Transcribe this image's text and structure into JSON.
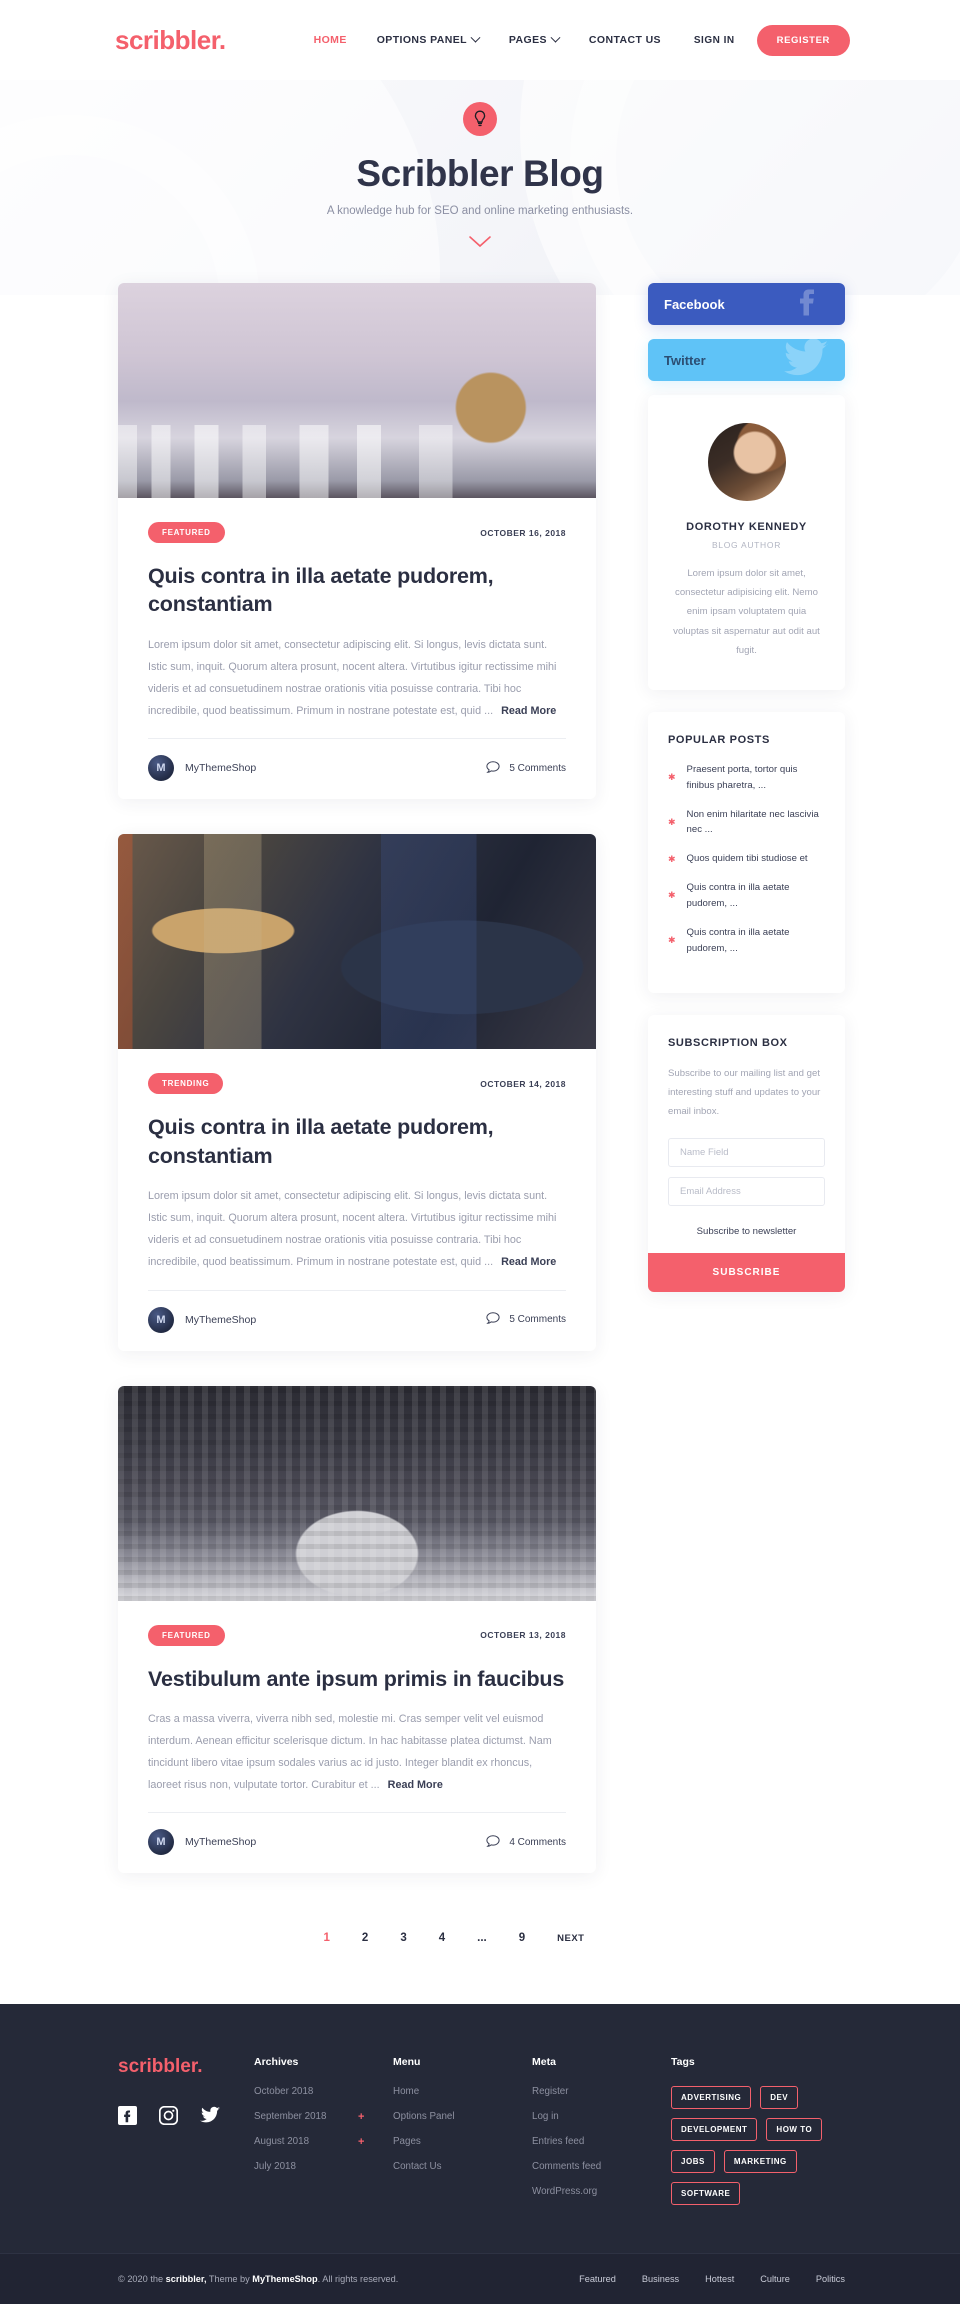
{
  "header": {
    "logo": "scribbler.",
    "nav": [
      {
        "label": "HOME",
        "active": true,
        "caret": false
      },
      {
        "label": "OPTIONS PANEL",
        "active": false,
        "caret": true
      },
      {
        "label": "PAGES",
        "active": false,
        "caret": true
      },
      {
        "label": "CONTACT US",
        "active": false,
        "caret": false
      }
    ],
    "signin_label": "SIGN IN",
    "register_label": "REGISTER"
  },
  "hero": {
    "icon": "lightbulb-icon",
    "title": "Scribbler Blog",
    "subtitle": "A knowledge hub for SEO and online marketing enthusiasts.",
    "scroll_icon": "chevron-down-icon"
  },
  "posts": [
    {
      "thumb_class": "thumb-city",
      "thumb_name": "post-image-woman-city-skyline",
      "badge": "FEATURED",
      "date": "OCTOBER 16, 2018",
      "title": "Quis contra in illa aetate pudorem, constantiam",
      "excerpt": "Lorem ipsum dolor sit amet, consectetur adipiscing elit. Si longus, levis dictata sunt. Istic sum, inquit. Quorum altera prosunt, nocent altera. Virtutibus igitur rectissime mihi videris et ad consuetudinem nostrae orationis vitia posuisse contraria. Tibi hoc incredibile, quod beatissimum. Primum in nostrane potestate est, quid ...",
      "read_more": "Read More",
      "author": "MyThemeShop",
      "comments": "5 Comments"
    },
    {
      "thumb_class": "thumb-painter",
      "thumb_name": "post-image-street-painter",
      "badge": "TRENDING",
      "date": "OCTOBER 14, 2018",
      "title": "Quis contra in illa aetate pudorem, constantiam",
      "excerpt": "Lorem ipsum dolor sit amet, consectetur adipiscing elit. Si longus, levis dictata sunt. Istic sum, inquit. Quorum altera prosunt, nocent altera. Virtutibus igitur rectissime mihi videris et ad consuetudinem nostrae orationis vitia posuisse contraria. Tibi hoc incredibile, quod beatissimum. Primum in nostrane potestate est, quid ...",
      "read_more": "Read More",
      "author": "MyThemeShop",
      "comments": "5 Comments"
    },
    {
      "thumb_class": "thumb-crowd",
      "thumb_name": "post-image-crowd-dance",
      "badge": "FEATURED",
      "date": "OCTOBER 13, 2018",
      "title": "Vestibulum ante ipsum primis in faucibus",
      "excerpt": "Cras a massa viverra, viverra nibh sed, molestie mi. Cras semper velit vel euismod interdum. Aenean efficitur scelerisque dictum. In hac habitasse platea dictumst. Nam tincidunt libero vitae ipsum sodales varius ac id justo. Integer blandit ex rhoncus, laoreet risus non, vulputate tortor. Curabitur et ...",
      "read_more": "Read More",
      "author": "MyThemeShop",
      "comments": "4 Comments"
    }
  ],
  "pagination": {
    "pages": [
      "1",
      "2",
      "3",
      "4",
      "...",
      "9"
    ],
    "active": "1",
    "next_label": "NEXT"
  },
  "sidebar": {
    "facebook_label": "Facebook",
    "twitter_label": "Twitter",
    "author": {
      "name": "DOROTHY KENNEDY",
      "role": "BLOG AUTHOR",
      "bio": "Lorem ipsum dolor sit amet, consectetur adipisicing elit. Nemo enim ipsam voluptatem quia voluptas sit aspernatur aut odit aut fugit."
    },
    "popular": {
      "title": "POPULAR POSTS",
      "items": [
        "Praesent porta, tortor quis finibus pharetra, ...",
        "Non enim hilaritate nec lascivia nec ...",
        "Quos quidem tibi studiose et",
        "Quis contra in illa aetate pudorem, ...",
        "Quis contra in illa aetate pudorem, ..."
      ]
    },
    "subscription": {
      "title": "SUBSCRIPTION BOX",
      "description": "Subscribe to our mailing list and get interesting stuff and updates to your email inbox.",
      "name_placeholder": "Name Field",
      "email_placeholder": "Email Address",
      "name_value": "",
      "email_value": "",
      "note": "Subscribe to newsletter",
      "button": "SUBSCRIBE"
    }
  },
  "footer": {
    "logo": "scribbler.",
    "socials": [
      "facebook-icon",
      "instagram-icon",
      "twitter-icon"
    ],
    "columns": [
      {
        "head": "Archives",
        "links": [
          {
            "label": "October 2018",
            "plus": false
          },
          {
            "label": "September 2018",
            "plus": false
          },
          {
            "label": "August 2018",
            "plus": false
          },
          {
            "label": "July 2018",
            "plus": false
          }
        ]
      },
      {
        "head": "Menu",
        "links": [
          {
            "label": "Home",
            "plus": false
          },
          {
            "label": "Options Panel",
            "plus": true
          },
          {
            "label": "Pages",
            "plus": true
          },
          {
            "label": "Contact Us",
            "plus": false
          }
        ]
      },
      {
        "head": "Meta",
        "links": [
          {
            "label": "Register",
            "plus": false
          },
          {
            "label": "Log in",
            "plus": false
          },
          {
            "label": "Entries feed",
            "plus": false
          },
          {
            "label": "Comments feed",
            "plus": false
          },
          {
            "label": "WordPress.org",
            "plus": false
          }
        ]
      }
    ],
    "tags_head": "Tags",
    "tags": [
      "ADVERTISING",
      "DEV",
      "DEVELOPMENT",
      "HOW TO",
      "JOBS",
      "MARKETING",
      "SOFTWARE"
    ]
  },
  "bottom": {
    "copyright_pre": "© 2020 the ",
    "copyright_brand": "scribbler,",
    "copyright_mid": " Theme by ",
    "copyright_theme": "MyThemeShop",
    "copyright_post": ". All rights reserved.",
    "links": [
      "Featured",
      "Business",
      "Hottest",
      "Culture",
      "Politics"
    ]
  },
  "colors": {
    "accent": "#f4606c",
    "dark": "#2b2f42",
    "footer_bg": "#252938",
    "bottom_bg": "#212433",
    "facebook": "#3b5bbf",
    "twitter": "#5fc3f7"
  }
}
